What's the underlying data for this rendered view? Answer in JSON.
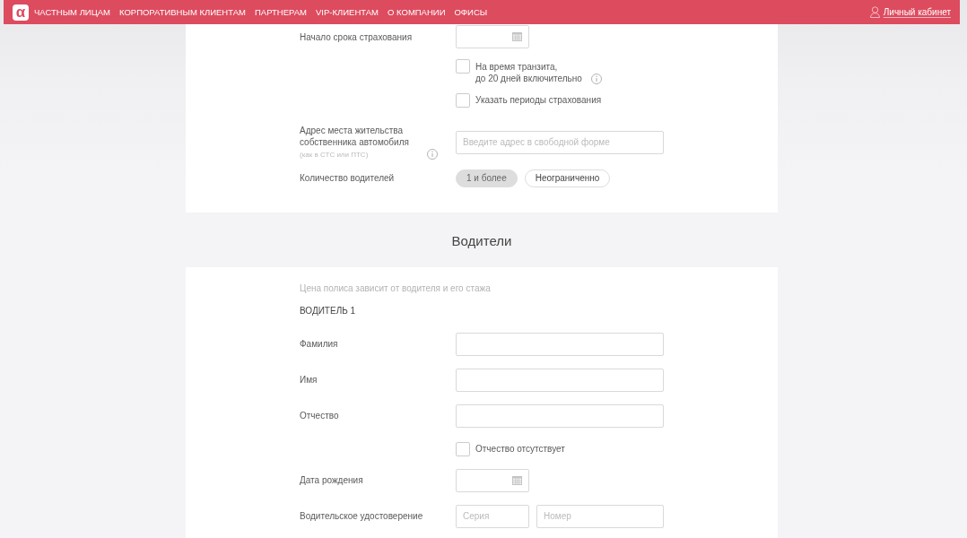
{
  "header": {
    "logo": "α",
    "nav": [
      "ЧАСТНЫМ ЛИЦАМ",
      "КОРПОРАТИВНЫМ КЛИЕНТАМ",
      "ПАРТНЕРАМ",
      "VIP-КЛИЕНТАМ",
      "О КОМПАНИИ",
      "ОФИСЫ"
    ],
    "account_link": "Личный кабинет"
  },
  "policy": {
    "rows": [
      {
        "kind": "date",
        "label": "Начало срока страхования"
      },
      {
        "kind": "checkbox",
        "text": "На время транзита,\nдо 20 дней включительно",
        "checked": false,
        "info": true
      },
      {
        "kind": "checkbox",
        "text": "Указать периоды страхования",
        "checked": false
      },
      {
        "kind": "text",
        "label": "Адрес места жительства собственника автомобиля",
        "hint": "(как в СТС или ПТС)",
        "info": true,
        "placeholder": "Введите адрес в свободной форме"
      },
      {
        "kind": "pills",
        "label": "Количество водителей",
        "options": [
          {
            "label": "1 и более",
            "selected": true
          },
          {
            "label": "Неограниченно",
            "selected": false
          }
        ]
      }
    ]
  },
  "drivers": {
    "title": "Водители",
    "note": "Цена полиса зависит от водителя и его стажа",
    "driver_title": "ВОДИТЕЛЬ 1",
    "rows": [
      {
        "kind": "text",
        "label": "Фамилия"
      },
      {
        "kind": "text",
        "label": "Имя"
      },
      {
        "kind": "text",
        "label": "Отчество"
      },
      {
        "kind": "checkbox",
        "text": "Отчество отсутствует",
        "checked": false
      },
      {
        "kind": "date",
        "label": "Дата рождения"
      },
      {
        "kind": "pair",
        "label": "Водительское удостоверение",
        "fields": [
          {
            "placeholder": "Серия"
          },
          {
            "placeholder": "Номер"
          }
        ]
      }
    ]
  }
}
